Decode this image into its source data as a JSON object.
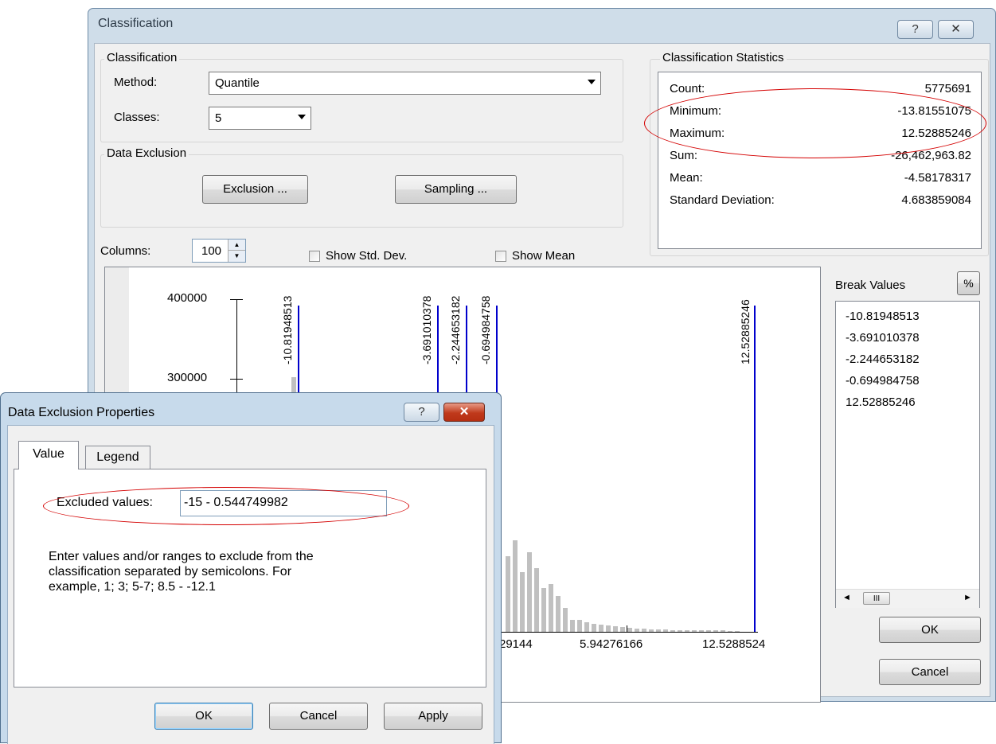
{
  "classification": {
    "window_title": "Classification",
    "help_btn": "?",
    "close_btn": "✕",
    "group_title": "Classification",
    "method_label": "Method:",
    "method_value": "Quantile",
    "classes_label": "Classes:",
    "classes_value": "5",
    "exclusion_group": "Data Exclusion",
    "exclusion_btn": "Exclusion ...",
    "sampling_btn": "Sampling ...",
    "columns_label": "Columns:",
    "columns_value": "100",
    "show_std_dev": "Show Std. Dev.",
    "show_mean": "Show Mean",
    "stats_title": "Classification Statistics",
    "stats": [
      {
        "label": "Count:",
        "value": "5775691"
      },
      {
        "label": "Minimum:",
        "value": "-13.81551075"
      },
      {
        "label": "Maximum:",
        "value": "12.52885246"
      },
      {
        "label": "Sum:",
        "value": "-26,462,963.82"
      },
      {
        "label": "Mean:",
        "value": "-4.58178317"
      },
      {
        "label": "Standard Deviation:",
        "value": "4.683859084"
      }
    ],
    "break_values_label": "Break Values",
    "percent_btn": "%",
    "break_values": [
      "-10.81948513",
      "-3.691010378",
      "-2.244653182",
      "-0.694984758",
      "12.52885246"
    ],
    "scroll_thumb": "III",
    "ok": "OK",
    "cancel": "Cancel",
    "colors": {
      "break_line": "#0000cc",
      "bar": "#c0c0c0",
      "highlight_oval": "#d40000"
    }
  },
  "chart_data": {
    "type": "bar",
    "y_ticks": [
      "400000",
      "300000"
    ],
    "x_ticks": [
      "29144",
      "5.94276166",
      "12.5288524"
    ],
    "break_lines": [
      "-10.81948513",
      "-3.691010378",
      "-2.244653182",
      "-0.694984758",
      "12.52885246"
    ],
    "visible_bar_heights": [
      95,
      115,
      75,
      100,
      80,
      55,
      60,
      45,
      30,
      15,
      15,
      12,
      10,
      9,
      8,
      7,
      6,
      5,
      4,
      4,
      3,
      3,
      3,
      2,
      2,
      2,
      2,
      2,
      2,
      2,
      2,
      1,
      1
    ],
    "visible_bar_heights_note": ""
  },
  "data_exclusion": {
    "window_title": "Data Exclusion Properties",
    "help_btn": "?",
    "close_btn": "✕",
    "tab_value": "Value",
    "tab_legend": "Legend",
    "excluded_label": "Excluded values:",
    "excluded_value": "-15 - 0.544749982",
    "help_line1": "Enter values and/or ranges to exclude from the",
    "help_line2": "classification separated by semicolons. For",
    "help_line3": "example, 1; 3; 5-7; 8.5 - -12.1",
    "ok": "OK",
    "cancel": "Cancel",
    "apply": "Apply"
  }
}
